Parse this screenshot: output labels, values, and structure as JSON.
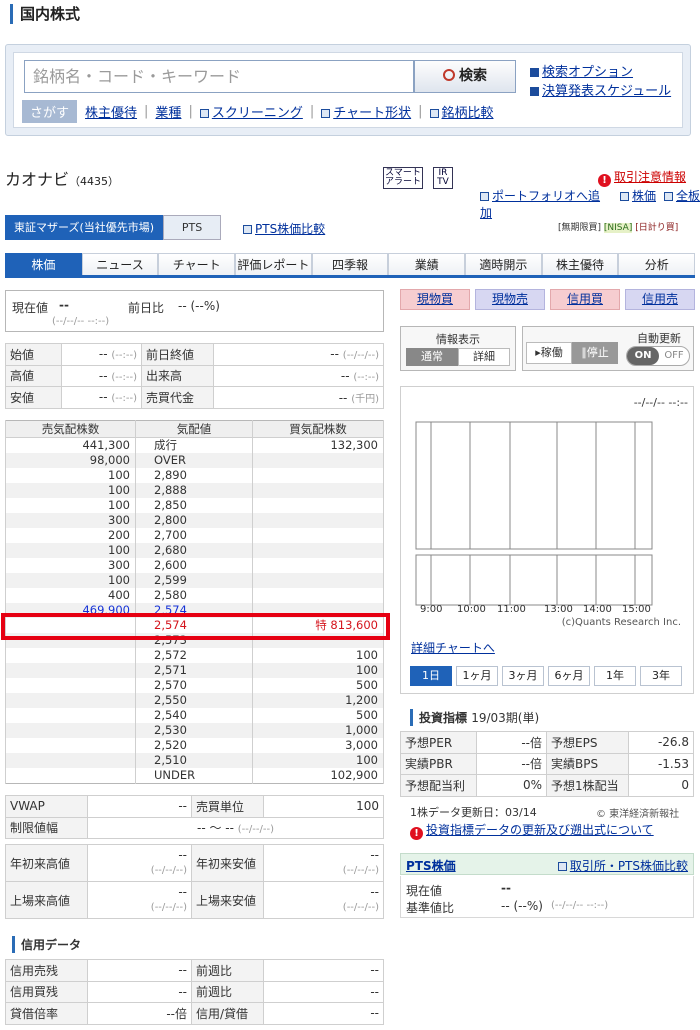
{
  "page_title": "国内株式",
  "search": {
    "placeholder": "銘柄名・コード・キーワード",
    "button": "検索",
    "option_link": "検索オプション",
    "schedule_link": "決算発表スケジュール",
    "sagasu": "さがす",
    "links": [
      "株主優待",
      "業種",
      "スクリーニング",
      "チャート形状",
      "銘柄比較"
    ]
  },
  "stock": {
    "name": "カオナビ",
    "code": "（4435）",
    "smart_alert": "スマート アラート",
    "irtv": "IR TV",
    "caution": "取引注意情報",
    "portfolio": "ポートフォリオへ追加",
    "kabuka": "株価",
    "zenko": "全板"
  },
  "market": {
    "primary": "東証マザーズ(当社優先市場)",
    "pts": "PTS",
    "pts_compare": "PTS株価比較",
    "badges": [
      "[無期限買]",
      "[NISA]",
      "[日計り買]"
    ]
  },
  "nav_tabs": [
    "株価",
    "ニュース",
    "チャート",
    "評価レポート",
    "四季報",
    "業績",
    "適時開示",
    "株主優待",
    "分析"
  ],
  "price": {
    "label": "現在値",
    "value": "--",
    "change_label": "前日比",
    "change": "-- (--%)",
    "time": "(--/--/-- --:--)"
  },
  "trade_buttons": [
    "現物買",
    "現物売",
    "信用買",
    "信用売"
  ],
  "info_display": {
    "label": "情報表示",
    "normal": "通常",
    "detail": "詳細"
  },
  "operation": {
    "running": "稼働",
    "stop": "停止"
  },
  "auto_update": {
    "label": "自動更新",
    "on": "ON",
    "off": "OFF"
  },
  "stats": [
    [
      "始値",
      "--",
      "(--:--)",
      "前日終値",
      "--",
      "(--/--/--)"
    ],
    [
      "高値",
      "--",
      "(--:--)",
      "出来高",
      "--",
      "(--:--)"
    ],
    [
      "安値",
      "--",
      "(--:--)",
      "売買代金",
      "--",
      "(千円)"
    ]
  ],
  "orderbook": {
    "headers": [
      "売気配株数",
      "気配値",
      "買気配株数"
    ],
    "rows": [
      [
        "441,300",
        "成行",
        "132,300"
      ],
      [
        "98,000",
        "OVER",
        ""
      ],
      [
        "100",
        "2,890",
        ""
      ],
      [
        "100",
        "2,888",
        ""
      ],
      [
        "100",
        "2,850",
        ""
      ],
      [
        "300",
        "2,800",
        ""
      ],
      [
        "200",
        "2,700",
        ""
      ],
      [
        "100",
        "2,680",
        ""
      ],
      [
        "300",
        "2,600",
        ""
      ],
      [
        "100",
        "2,599",
        ""
      ],
      [
        "400",
        "2,580",
        ""
      ],
      [
        "469,900",
        "2,574",
        ""
      ],
      [
        "",
        "2,574",
        "特 813,600"
      ],
      [
        "",
        "2,573",
        ""
      ],
      [
        "",
        "2,572",
        "100"
      ],
      [
        "",
        "2,571",
        "100"
      ],
      [
        "",
        "2,570",
        "500"
      ],
      [
        "",
        "2,550",
        "1,200"
      ],
      [
        "",
        "2,540",
        "500"
      ],
      [
        "",
        "2,530",
        "1,000"
      ],
      [
        "",
        "2,520",
        "3,000"
      ],
      [
        "",
        "2,510",
        "100"
      ],
      [
        "",
        "UNDER",
        "102,900"
      ]
    ]
  },
  "vwap": {
    "label": "VWAP",
    "value": "--",
    "unit_label": "売買単位",
    "unit": "100"
  },
  "limit": {
    "label": "制限値幅",
    "value": "-- 〜 --",
    "time": "(--/--/--)"
  },
  "highs": [
    [
      "年初来高値",
      "--",
      "(--/--/--)",
      "年初来安値",
      "--",
      "(--/--/--)"
    ],
    [
      "上場来高値",
      "--",
      "(--/--/--)",
      "上場来安値",
      "--",
      "(--/--/--)"
    ]
  ],
  "margin_title": "信用データ",
  "margin": [
    [
      "信用売残",
      "--",
      "前週比",
      "--"
    ],
    [
      "信用買残",
      "--",
      "前週比",
      "--"
    ],
    [
      "貸借倍率",
      "--倍",
      "信用/貸借",
      "--"
    ]
  ],
  "chart": {
    "timestamp": "--/--/-- --:--",
    "times": [
      "9:00",
      "10:00",
      "11:00",
      "13:00",
      "14:00",
      "15:00"
    ],
    "credit": "(c)Quants Research Inc.",
    "detail_link": "詳細チャートへ",
    "periods": [
      "1日",
      "1ヶ月",
      "3ヶ月",
      "6ヶ月",
      "1年",
      "3年"
    ]
  },
  "indicators": {
    "title": "投資指標",
    "period": "19/03期(単)",
    "rows": [
      [
        "予想PER",
        "--倍",
        "予想EPS",
        "-26.8"
      ],
      [
        "実績PBR",
        "--倍",
        "実績BPS",
        "-1.53"
      ],
      [
        "予想配当利",
        "0%",
        "予想1株配当",
        "0"
      ]
    ],
    "update": "1株データ更新日：03/14",
    "source": "© 東洋経済新報社",
    "notice": "投資指標データの更新及び遡出式について"
  },
  "pts_section": {
    "title": "PTS株価",
    "compare_link": "取引所・PTS株価比較",
    "price_label": "現在値",
    "price": "--",
    "base_label": "基準値比",
    "base": "-- (--%)",
    "base_time": "(--/--/-- --:--)"
  }
}
